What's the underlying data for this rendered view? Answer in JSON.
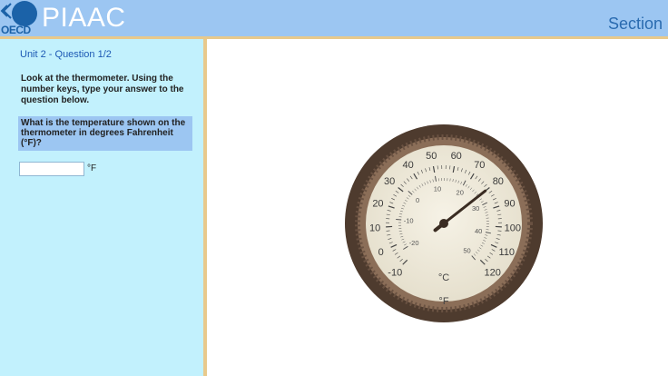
{
  "header": {
    "logo_org": "OECD",
    "logo_title": "PIAAC",
    "section_label": "Section"
  },
  "question": {
    "unit_label": "Unit 2 - Question 1/2",
    "instruction": "Look at the thermometer. Using the number keys, type your answer to the question below.",
    "prompt": "What is the temperature shown on the thermometer in degrees Fahrenheit (°F)?",
    "answer_value": "",
    "unit_suffix": "°F"
  },
  "thermometer": {
    "unit_f": "F",
    "unit_c": "C",
    "fahrenheit_labels": [
      "-10",
      "0",
      "10",
      "20",
      "30",
      "40",
      "50",
      "60",
      "70",
      "80",
      "90",
      "100",
      "110",
      "120"
    ],
    "celsius_labels": [
      "-20",
      "-10",
      "0",
      "10",
      "20",
      "30",
      "40",
      "50"
    ],
    "needle_reading_f": 80
  },
  "colors": {
    "header_bg": "#9cc6f2",
    "panel_bg": "#c2f1fd",
    "accent_border": "#e8c98c",
    "dial_rim": "#4e3b2e",
    "dial_face": "#efeadb"
  }
}
